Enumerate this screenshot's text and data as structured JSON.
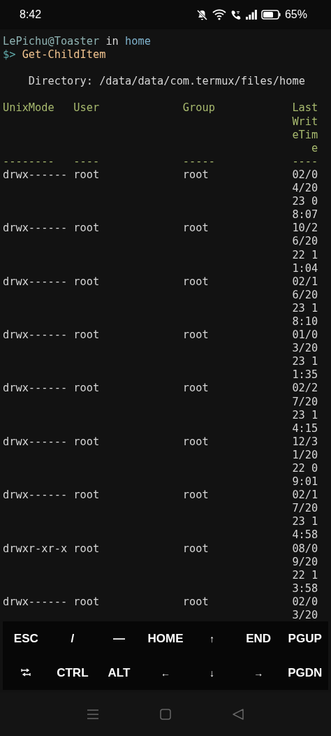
{
  "status_bar": {
    "time": "8:42",
    "battery": "65%"
  },
  "terminal": {
    "prompt": {
      "user_host": "LePichu@Toaster",
      "in": "in",
      "cwd": "home",
      "symbol": "$>",
      "command": "Get-ChildItem"
    },
    "directory": "Directory: /data/data/com.termux/files/home",
    "table": {
      "columns": [
        {
          "lines": [
            "UnixMode"
          ],
          "rule": "--------"
        },
        {
          "lines": [
            "User"
          ],
          "rule": "----"
        },
        {
          "lines": [
            "Group"
          ],
          "rule": "-----"
        },
        {
          "lines": [
            "Last",
            "Writ",
            "eTim",
            "e"
          ],
          "rule": "----"
        }
      ],
      "rows": [
        {
          "mode": "drwx------",
          "user": "root",
          "group": "root",
          "time": [
            "02/0",
            "4/20",
            "23 0",
            "8:07"
          ]
        },
        {
          "mode": "drwx------",
          "user": "root",
          "group": "root",
          "time": [
            "10/2",
            "6/20",
            "22 1",
            "1:04"
          ]
        },
        {
          "mode": "drwx------",
          "user": "root",
          "group": "root",
          "time": [
            "02/1",
            "6/20",
            "23 1",
            "8:10"
          ]
        },
        {
          "mode": "drwx------",
          "user": "root",
          "group": "root",
          "time": [
            "01/0",
            "3/20",
            "23 1",
            "1:35"
          ]
        },
        {
          "mode": "drwx------",
          "user": "root",
          "group": "root",
          "time": [
            "02/2",
            "7/20",
            "23 1",
            "4:15"
          ]
        },
        {
          "mode": "drwx------",
          "user": "root",
          "group": "root",
          "time": [
            "12/3",
            "1/20",
            "22 0",
            "9:01"
          ]
        },
        {
          "mode": "drwx------",
          "user": "root",
          "group": "root",
          "time": [
            "02/1",
            "7/20",
            "23 1",
            "4:58"
          ]
        },
        {
          "mode": "drwxr-xr-x",
          "user": "root",
          "group": "root",
          "time": [
            "08/0",
            "9/20",
            "22 1",
            "3:58"
          ]
        },
        {
          "mode": "drwx------",
          "user": "root",
          "group": "root",
          "time": [
            "02/0",
            "3/20"
          ]
        }
      ]
    }
  },
  "extra_keys": [
    [
      {
        "kind": "text",
        "label": "ESC"
      },
      {
        "kind": "text",
        "label": "/"
      },
      {
        "kind": "text",
        "label": "—"
      },
      {
        "kind": "text",
        "label": "HOME"
      },
      {
        "kind": "arrow",
        "label": "↑"
      },
      {
        "kind": "text",
        "label": "END"
      },
      {
        "kind": "text",
        "label": "PGUP"
      }
    ],
    [
      {
        "kind": "tab"
      },
      {
        "kind": "text",
        "label": "CTRL"
      },
      {
        "kind": "text",
        "label": "ALT"
      },
      {
        "kind": "arrow",
        "label": "←"
      },
      {
        "kind": "arrow",
        "label": "↓"
      },
      {
        "kind": "arrow",
        "label": "→"
      },
      {
        "kind": "text",
        "label": "PGDN"
      }
    ]
  ]
}
